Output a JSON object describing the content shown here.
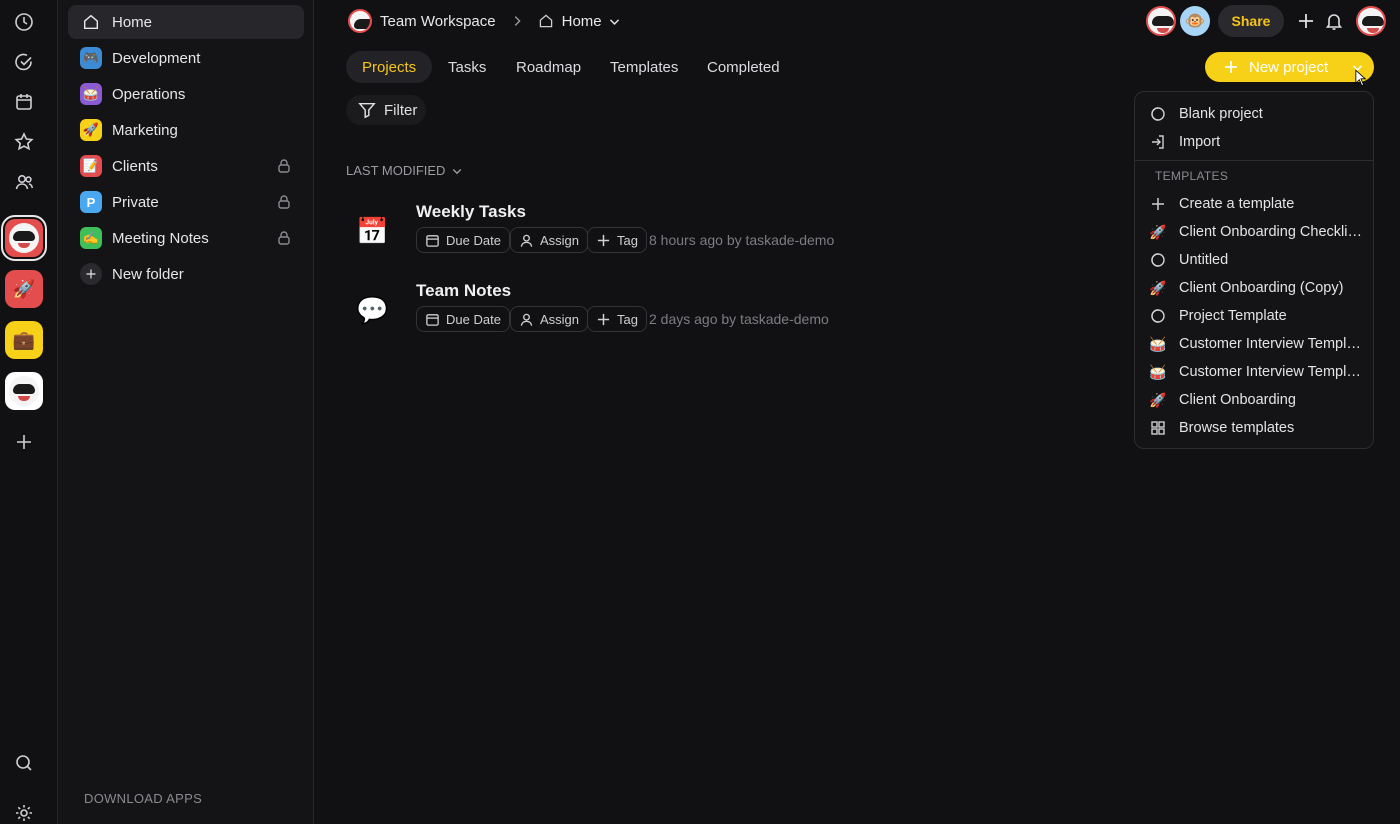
{
  "colors": {
    "accent": "#f5c518",
    "button_yellow": "#f7d117",
    "background": "#111113"
  },
  "rail": {
    "icons": [
      "clock-icon",
      "check-circle-icon",
      "calendar-icon",
      "star-icon",
      "people-icon",
      "search-icon",
      "settings-icon"
    ]
  },
  "sidebar": {
    "items": [
      {
        "label": "Home",
        "icon": "home-icon"
      },
      {
        "label": "Development",
        "icon": "🎮"
      },
      {
        "label": "Operations",
        "icon": "🥁"
      },
      {
        "label": "Marketing",
        "icon": "🚀"
      },
      {
        "label": "Clients",
        "icon": "📝",
        "locked": true
      },
      {
        "label": "Private",
        "icon": "P",
        "locked": true
      },
      {
        "label": "Meeting Notes",
        "icon": "✍",
        "locked": true
      },
      {
        "label": "New folder",
        "icon": "plus-icon"
      }
    ],
    "download_apps": "DOWNLOAD APPS"
  },
  "header": {
    "workspace": "Team Workspace",
    "breadcrumb_page": "Home",
    "share": "Share"
  },
  "tabs": [
    "Projects",
    "Tasks",
    "Roadmap",
    "Templates",
    "Completed"
  ],
  "new_project": "New project",
  "filter": "Filter",
  "sort": "LAST MODIFIED",
  "projects": [
    {
      "title": "Weekly Tasks",
      "emoji": "📅",
      "due": "Due Date",
      "assign": "Assign",
      "tag": "Tag",
      "meta": "8 hours ago by taskade-demo"
    },
    {
      "title": "Team Notes",
      "emoji": "💬",
      "due": "Due Date",
      "assign": "Assign",
      "tag": "Tag",
      "meta": "2 days ago by taskade-demo"
    }
  ],
  "dropdown": {
    "top_items": [
      {
        "label": "Blank project",
        "icon": "blank-project-icon"
      },
      {
        "label": "Import",
        "icon": "import-icon"
      }
    ],
    "section_label": "TEMPLATES",
    "template_items": [
      {
        "label": "Create a template",
        "icon": "plus-icon"
      },
      {
        "label": "Client Onboarding Checkli…",
        "icon": "🚀"
      },
      {
        "label": "Untitled",
        "icon": "blank-project-icon"
      },
      {
        "label": "Client Onboarding (Copy)",
        "icon": "🚀"
      },
      {
        "label": "Project Template",
        "icon": "blank-project-icon"
      },
      {
        "label": "Customer Interview Templ…",
        "icon": "🥁"
      },
      {
        "label": "Customer Interview Templ…",
        "icon": "🥁"
      },
      {
        "label": "Client Onboarding",
        "icon": "🚀"
      },
      {
        "label": "Browse templates",
        "icon": "grid-icon"
      }
    ]
  }
}
